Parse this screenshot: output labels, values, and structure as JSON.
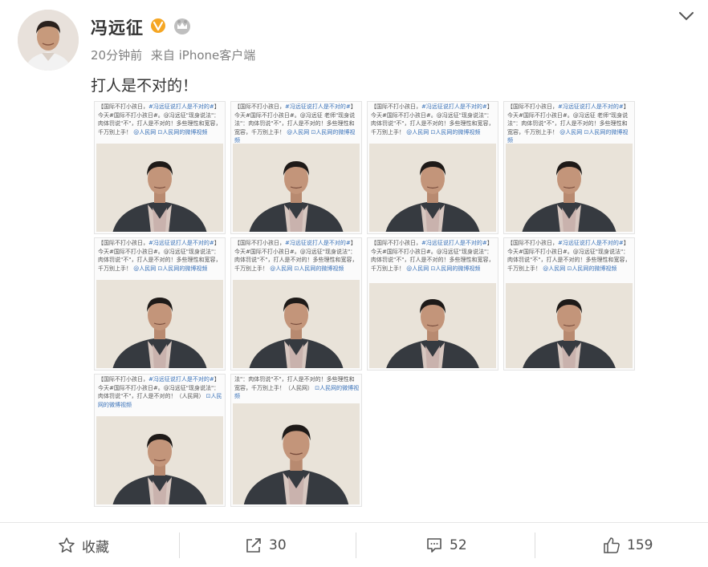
{
  "author": {
    "name": "冯远征",
    "verified_icon": "verified-v-badge",
    "level_icon": "vip-crown-badge"
  },
  "post": {
    "time": "20分钟前",
    "source": "来自 iPhone客户端",
    "text": "打人是不对的！"
  },
  "images": [
    {
      "top_text": "【国际不打小孩日，",
      "hl1": "#冯远征说打人是不对的#",
      "body": "】今天#国际不打小孩日#。@冯远征\"现身说法\"：肉体罚说\"不\"，打人是不对的！多些理性和宽容，千万别上手！",
      "link": "@人民网 ⊡人民网的微博视频"
    },
    {
      "top_text": "【国际不打小孩日，",
      "hl1": "#冯远征说打人是不对的#",
      "body": "】今天#国际不打小孩日#。@冯远征 老师\"现身说法\"：肉体罚说\"不\"，打人是不对的！多些理性和宽容，千万别上手！",
      "link": "@人民网 ⊡人民网的微博视频"
    },
    {
      "top_text": "【国际不打小孩日，",
      "hl1": "#冯远征说打人是不对的#",
      "body": "】今天#国际不打小孩日#。@冯远征\"现身说法\"：肉体罚说\"不\"，打人是不对的！多些理性和宽容，千万别上手！",
      "link": "@人民网 ⊡人民网的微博视频"
    },
    {
      "top_text": "【国际不打小孩日，",
      "hl1": "#冯远征说打人是不对的#",
      "body": "】今天#国际不打小孩日#。@冯远征 老师\"现身说法\"：肉体罚说\"不\"，打人是不对的！多些理性和宽容，千万别上手！",
      "link": "@人民网 ⊡人民网的微博视频"
    },
    {
      "top_text": "【国际不打小孩日，",
      "hl1": "#冯远征说打人是不对的#",
      "body": "】今天#国际不打小孩日#。@冯远征\"现身说法\"：肉体罚说\"不\"，打人是不对的！多些理性和宽容，千万别上手！",
      "link": "@人民网 ⊡人民网的微博视频"
    },
    {
      "top_text": "【国际不打小孩日，",
      "hl1": "#冯远征说打人是不对的#",
      "body": "】今天#国际不打小孩日#。@冯远征\"现身说法\"：肉体罚说\"不\"，打人是不对的！多些理性和宽容，千万别上手！",
      "link": "@人民网 ⊡人民网的微博视频"
    },
    {
      "top_text": "【国际不打小孩日，",
      "hl1": "#冯远征说打人是不对的#",
      "body": "】今天#国际不打小孩日#。@冯远征\"现身说法\"：肉体罚说\"不\"，打人是不对的！多些理性和宽容，千万别上手！",
      "link": "@人民网 ⊡人民网的微博视频"
    },
    {
      "top_text": "【国际不打小孩日，",
      "hl1": "#冯远征说打人是不对的#",
      "body": "】今天#国际不打小孩日#。@冯远征\"现身说法\"：肉体罚说\"不\"，打人是不对的！多些理性和宽容，千万别上手！",
      "link": "@人民网 ⊡人民网的微博视频"
    },
    {
      "top_text": "【国际不打小孩日，",
      "hl1": "#冯远征说打人是不对的#",
      "body": "】今天#国际不打小孩日#。@冯远征\"现身说法\"：肉体罚说\"不\"，打人是不对的！（人民网）",
      "link": "⊡人民网的微博视频"
    },
    {
      "top_text": "",
      "hl1": "",
      "body": "法\"：肉体罚说\"不\"，打人是不对的！多些理性和宽容，千万别上手！（人民网）",
      "link": "⊡人民网的微博视频"
    }
  ],
  "actions": {
    "favorite_label": "收藏",
    "forward_count": "30",
    "comment_count": "52",
    "like_count": "159"
  }
}
